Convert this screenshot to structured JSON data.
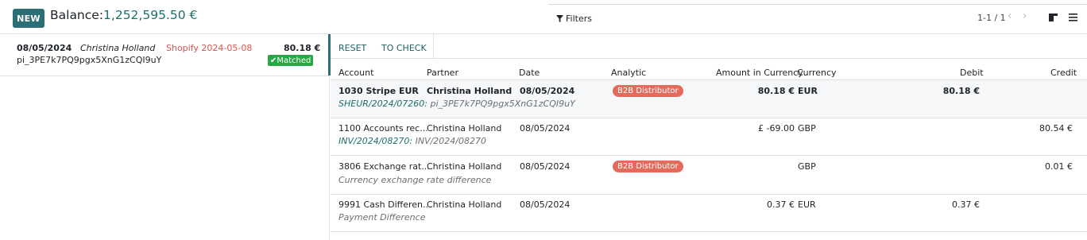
{
  "topbar": {
    "new_label": "NEW",
    "balance_label": "Balance:",
    "balance_value": "1,252,595.50 €",
    "filters_label": "Filters",
    "pager": "1-1 / 1"
  },
  "statement_line": {
    "date": "08/05/2024",
    "partner": "Christina Holland",
    "label": "Shopify 2024-05-08",
    "amount": "80.18 €",
    "reference": "pi_3PE7k7PQ9pgx5XnG1zCQI9uY",
    "status": "✔Matched"
  },
  "actions": {
    "reset": "RESET",
    "to_check": "TO CHECK"
  },
  "columns": {
    "account": "Account",
    "partner": "Partner",
    "date": "Date",
    "analytic": "Analytic",
    "amount_currency": "Amount in Currency",
    "currency": "Currency",
    "debit": "Debit",
    "credit": "Credit"
  },
  "rows": [
    {
      "account": "1030 Stripe EUR",
      "partner": "Christina Holland",
      "date": "08/05/2024",
      "analytic": "B2B Distributor",
      "amount_currency": "80.18 €",
      "currency": "EUR",
      "debit": "80.18 €",
      "credit": "",
      "sub_link": "SHEUR/2024/07260:",
      "sub_text": " pi_3PE7k7PQ9pgx5XnG1zCQI9uY"
    },
    {
      "account": "1100 Accounts rec...",
      "partner": "Christina Holland",
      "date": "08/05/2024",
      "analytic": "",
      "amount_currency": "£ -69.00",
      "currency": "GBP",
      "debit": "",
      "credit": "80.54 €",
      "sub_link": "INV/2024/08270:",
      "sub_text": " INV/2024/08270"
    },
    {
      "account": "3806 Exchange rat...",
      "partner": "Christina Holland",
      "date": "08/05/2024",
      "analytic": "B2B Distributor",
      "amount_currency": "",
      "currency": "GBP",
      "debit": "",
      "credit": "0.01 €",
      "sub_link": "",
      "sub_text": "Currency exchange rate difference"
    },
    {
      "account": "9991 Cash Differen...",
      "partner": "Christina Holland",
      "date": "08/05/2024",
      "analytic": "",
      "amount_currency": "0.37 €",
      "currency": "EUR",
      "debit": "0.37 €",
      "credit": "",
      "sub_link": "",
      "sub_text": "Payment Difference"
    }
  ],
  "icons": {
    "filter": "funnel-icon",
    "prev": "chevron-left-icon",
    "next": "chevron-right-icon",
    "kanban": "kanban-view-icon",
    "list": "list-view-icon"
  },
  "colors": {
    "primary": "#2c6e76",
    "balance": "#1c6f6b",
    "matched": "#28a745",
    "tag": "#e46a5c",
    "shop": "#d9534f"
  }
}
